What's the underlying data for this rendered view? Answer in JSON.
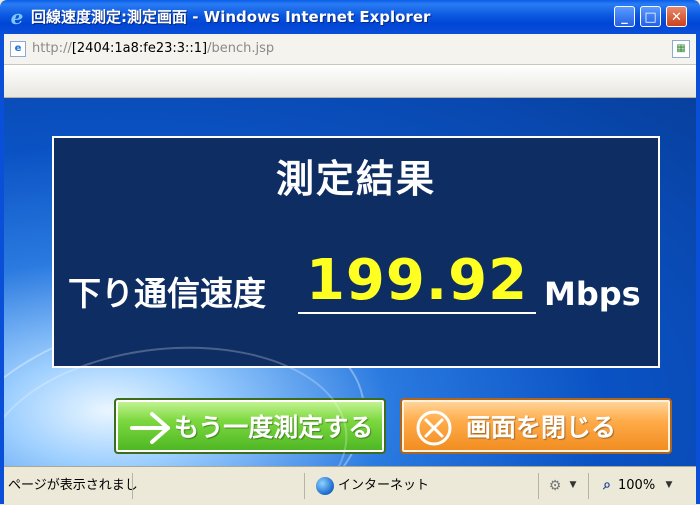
{
  "window": {
    "title": "回線速度測定:測定画面 - Windows Internet Explorer",
    "minimize_label": "_",
    "maximize_label": "□",
    "close_label": "✕"
  },
  "address": {
    "scheme": "http://",
    "host": "[2404:1a8:fe23:3::1]",
    "path": "/bench.jsp"
  },
  "result": {
    "title": "測定結果",
    "speed_label": "下り通信速度",
    "speed_value": "199.92",
    "speed_unit": "Mbps",
    "value_color": "#ffff22"
  },
  "buttons": {
    "retest_label": "もう一度測定する",
    "close_label": "画面を閉じる"
  },
  "status": {
    "text": "ページが表示されまし",
    "zone": "インターネット",
    "zoom": "100%"
  },
  "colors": {
    "panel": "#0e2d63",
    "title_bar": "#0b58e0",
    "retest_green": "#7cd83f",
    "close_orange": "#ffac4a"
  }
}
